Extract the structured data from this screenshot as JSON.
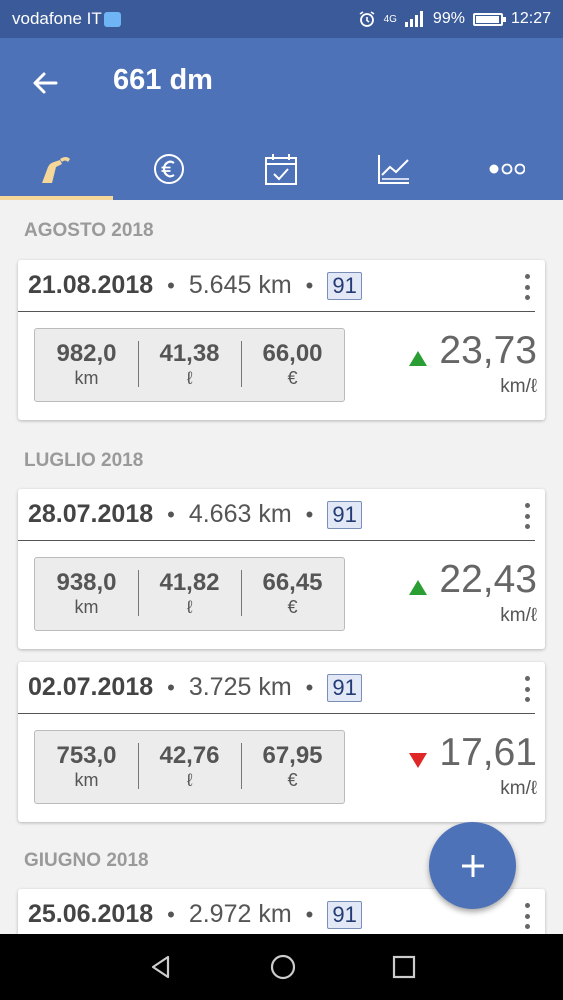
{
  "status_bar": {
    "carrier": "vodafone IT",
    "network": "4G",
    "battery": "99%",
    "time": "12:27"
  },
  "app_bar": {
    "title": "661 dm"
  },
  "tabs": [
    {
      "icon": "fuel-pump-icon",
      "active": true
    },
    {
      "icon": "euro-icon",
      "active": false
    },
    {
      "icon": "calendar-check-icon",
      "active": false
    },
    {
      "icon": "chart-icon",
      "active": false
    },
    {
      "icon": "more-dots-icon",
      "active": false
    }
  ],
  "sections": [
    {
      "title": "AGOSTO 2018",
      "entries": [
        {
          "date": "21.08.2018",
          "odometer": "5.645 km",
          "octane": "91",
          "distance": "982,0",
          "distance_unit": "km",
          "liters": "41,38",
          "liters_unit": "ℓ",
          "cost": "66,00",
          "cost_unit": "€",
          "trend": "up",
          "consumption": "23,73",
          "consumption_unit": "km/ℓ"
        }
      ]
    },
    {
      "title": "LUGLIO 2018",
      "entries": [
        {
          "date": "28.07.2018",
          "odometer": "4.663 km",
          "octane": "91",
          "distance": "938,0",
          "distance_unit": "km",
          "liters": "41,82",
          "liters_unit": "ℓ",
          "cost": "66,45",
          "cost_unit": "€",
          "trend": "up",
          "consumption": "22,43",
          "consumption_unit": "km/ℓ"
        },
        {
          "date": "02.07.2018",
          "odometer": "3.725 km",
          "octane": "91",
          "distance": "753,0",
          "distance_unit": "km",
          "liters": "42,76",
          "liters_unit": "ℓ",
          "cost": "67,95",
          "cost_unit": "€",
          "trend": "down",
          "consumption": "17,61",
          "consumption_unit": "km/ℓ"
        }
      ]
    },
    {
      "title": "GIUGNO 2018",
      "entries": [
        {
          "date": "25.06.2018",
          "odometer": "2.972 km",
          "octane": "91"
        }
      ]
    }
  ],
  "colors": {
    "primary": "#4e72b8",
    "status_bar": "#3a5a99",
    "tab_indicator": "#f5d79a",
    "trend_up": "#2a9d33",
    "trend_down": "#e02727"
  }
}
